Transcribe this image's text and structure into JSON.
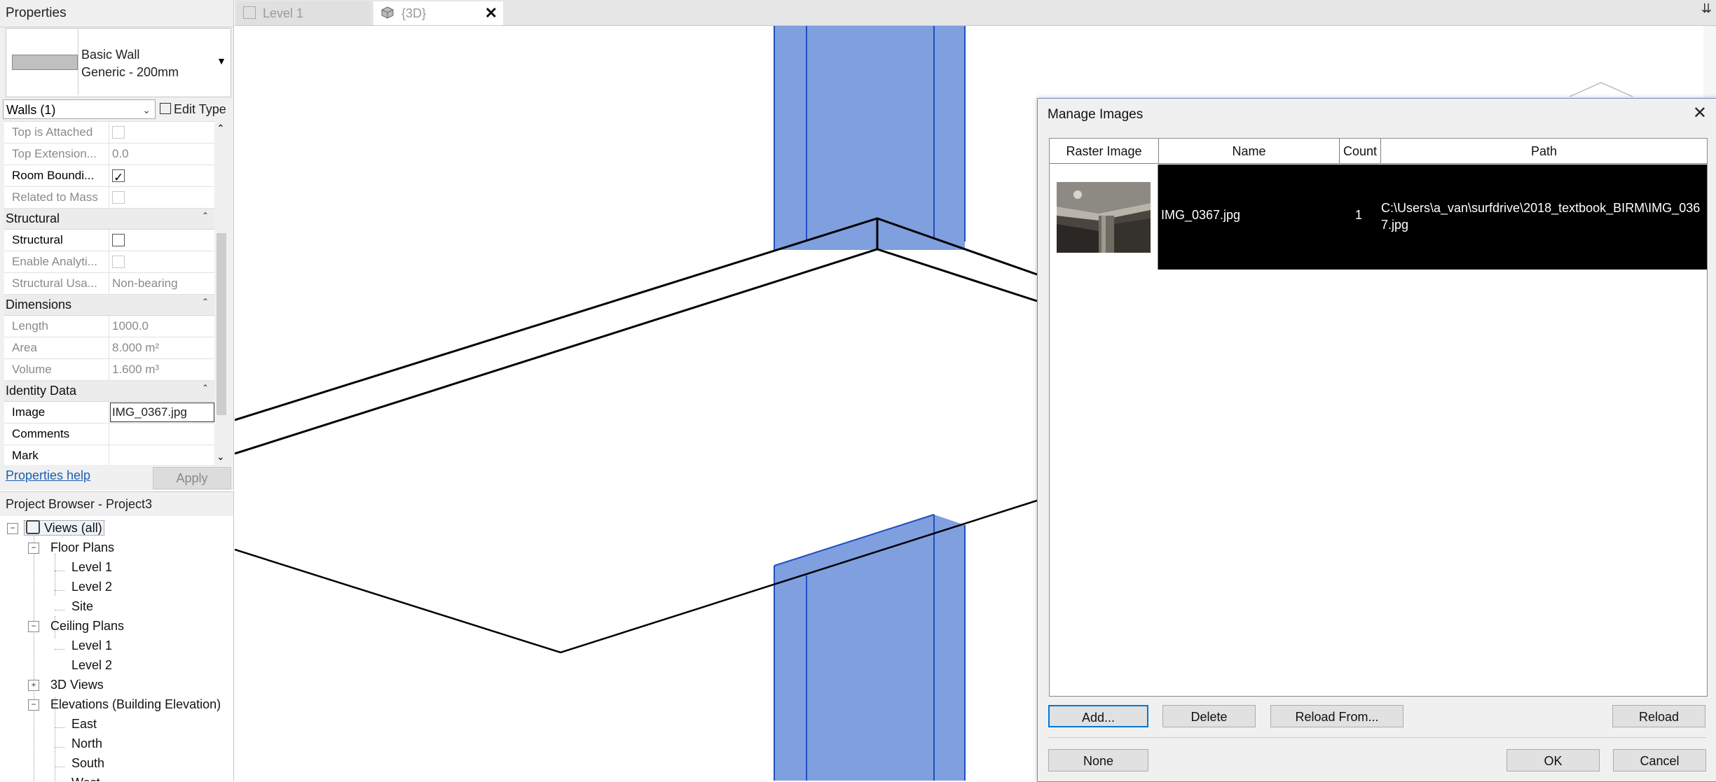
{
  "properties": {
    "title": "Properties",
    "type_family": "Basic Wall",
    "type_name": "Generic - 200mm",
    "instance_selector": "Walls (1)",
    "edit_type": "Edit Type",
    "rows": {
      "top_attached": "Top is Attached",
      "top_extension_label": "Top Extension...",
      "top_extension_value": "0.0",
      "room_bounding": "Room Boundi...",
      "related_to_mass": "Related to Mass",
      "group_structural": "Structural",
      "structural": "Structural",
      "enable_analytical": "Enable Analyti...",
      "structural_usage_label": "Structural Usa...",
      "structural_usage_value": "Non-bearing",
      "group_dimensions": "Dimensions",
      "length_label": "Length",
      "length_value": "1000.0",
      "area_label": "Area",
      "area_value": "8.000 m²",
      "volume_label": "Volume",
      "volume_value": "1.600 m³",
      "group_identity": "Identity Data",
      "image_label": "Image",
      "image_value": "IMG_0367.jpg",
      "comments_label": "Comments",
      "mark_label": "Mark"
    },
    "checkboxes": {
      "top_attached": false,
      "room_bounding": true,
      "related_to_mass": false,
      "structural": false,
      "enable_analytical": false
    },
    "help_link": "Properties help",
    "apply": "Apply"
  },
  "browser": {
    "title": "Project Browser - Project3",
    "views_all": "Views (all)",
    "floor_plans": "Floor Plans",
    "fp_level1": "Level 1",
    "fp_level2": "Level 2",
    "fp_site": "Site",
    "ceiling_plans": "Ceiling Plans",
    "cp_level1": "Level 1",
    "cp_level2": "Level 2",
    "views_3d": "3D Views",
    "elevations": "Elevations (Building Elevation)",
    "el_east": "East",
    "el_north": "North",
    "el_south": "South",
    "el_west": "West"
  },
  "tabs": {
    "level1": "Level 1",
    "three_d": "{3D}",
    "close": "✕",
    "menu": "⇊"
  },
  "dialog": {
    "title": "Manage Images",
    "close": "✕",
    "columns": {
      "raster": "Raster Image",
      "name": "Name",
      "count": "Count",
      "path": "Path"
    },
    "row": {
      "name": "IMG_0367.jpg",
      "count": "1",
      "path": "C:\\Users\\a_van\\surfdrive\\2018_textbook_BIRM\\IMG_0367.jpg"
    },
    "buttons": {
      "add": "Add...",
      "delete": "Delete",
      "reload_from": "Reload From...",
      "reload": "Reload",
      "none": "None",
      "ok": "OK",
      "cancel": "Cancel"
    }
  },
  "colors": {
    "wall_fill": "#7f9fdf",
    "wall_edge": "#1f4fbf",
    "selection_black": "#000000",
    "link_blue": "#1a5fb4"
  }
}
